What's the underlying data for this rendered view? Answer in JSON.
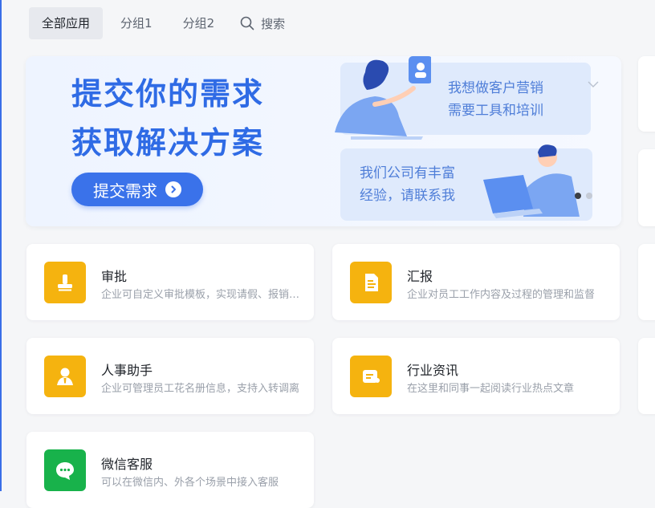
{
  "tabs": [
    {
      "label": "全部应用",
      "active": true
    },
    {
      "label": "分组1",
      "active": false
    },
    {
      "label": "分组2",
      "active": false
    }
  ],
  "search": {
    "label": "搜索",
    "icon": "search-icon"
  },
  "banner": {
    "title_line1": "提交你的需求",
    "title_line2": "获取解决方案",
    "button_label": "提交需求",
    "bubble1": {
      "line1": "我想做客户营销",
      "line2": "需要工具和培训"
    },
    "bubble2": {
      "line1": "我们公司有丰富",
      "line2": "经验，请联系我"
    },
    "carousel": {
      "total": 2,
      "active": 1
    }
  },
  "apps": [
    {
      "name": "审批",
      "desc": "企业可自定义审批模板，实现请假、报销等审批流程",
      "icon": "stamp-icon",
      "color": "#f5b30f"
    },
    {
      "name": "汇报",
      "desc": "企业对员工工作内容及过程的管理和监督",
      "icon": "report-doc-icon",
      "color": "#f5b30f"
    },
    {
      "name": "人事助手",
      "desc": "企业可管理员工花名册信息，支持入转调离",
      "icon": "person-icon",
      "color": "#f5b30f"
    },
    {
      "name": "行业资讯",
      "desc": "在这里和同事一起阅读行业热点文章",
      "icon": "news-icon",
      "color": "#f5b30f"
    },
    {
      "name": "微信客服",
      "desc": "可以在微信内、外各个场景中接入客服",
      "icon": "chat-bubble-icon",
      "color": "#18b24b"
    }
  ],
  "colors": {
    "accent": "#3a72ea",
    "title": "#2f6be5",
    "bubble_bg": "#dfeafc",
    "page_bg": "#f5f6f8"
  }
}
